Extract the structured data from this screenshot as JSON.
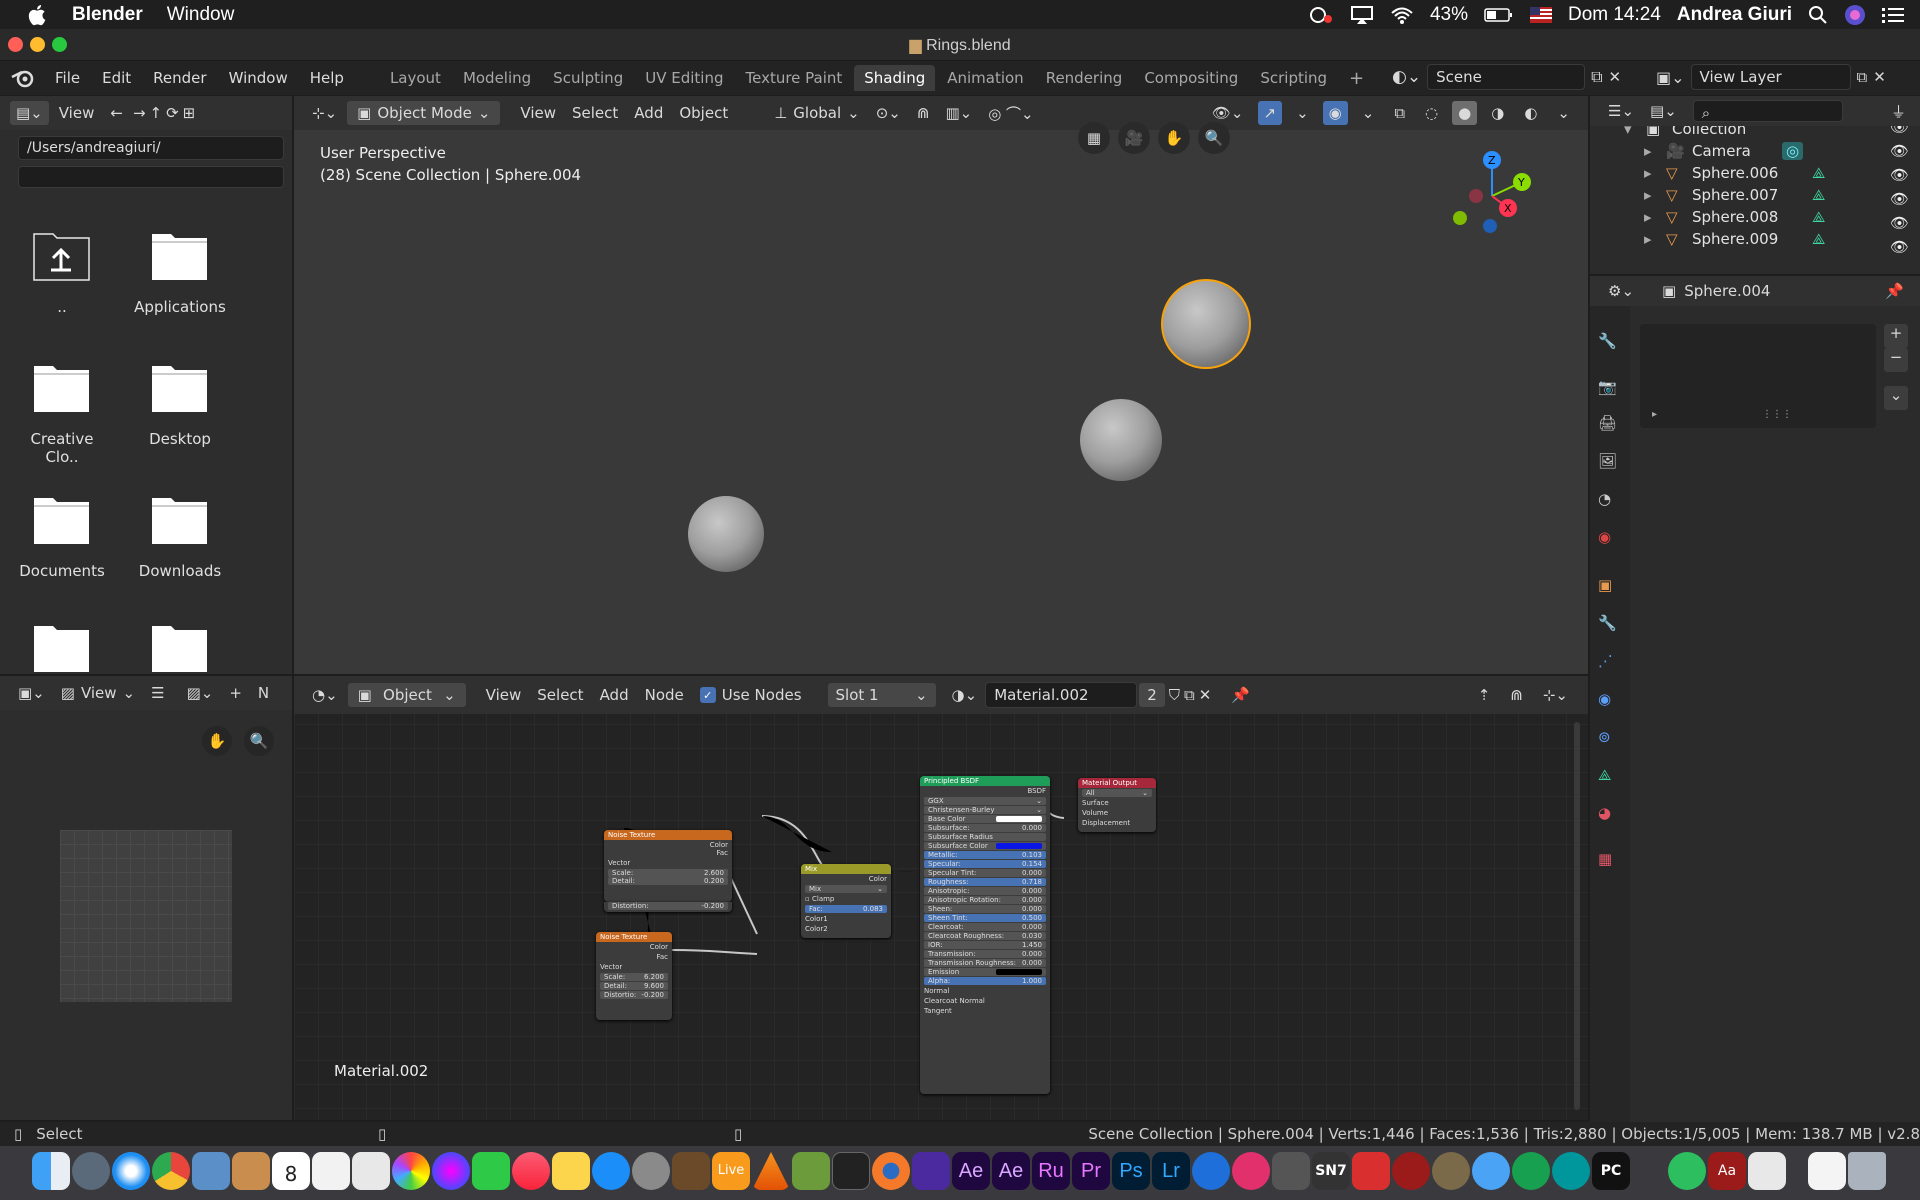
{
  "macbar": {
    "app": "Blender",
    "menu": "Window",
    "battery": "43%",
    "datetime": "Dom 14:24",
    "user": "Andrea Giuri"
  },
  "window": {
    "title": "Rings.blend"
  },
  "topbar": {
    "menus": [
      "File",
      "Edit",
      "Render",
      "Window",
      "Help"
    ],
    "tabs": [
      "Layout",
      "Modeling",
      "Sculpting",
      "UV Editing",
      "Texture Paint",
      "Shading",
      "Animation",
      "Rendering",
      "Compositing",
      "Scripting"
    ],
    "active_tab": "Shading",
    "scene": "Scene",
    "view_layer": "View Layer"
  },
  "filebrowser": {
    "view_label": "View",
    "path": "/Users/andreagiuri/",
    "filter": "",
    "items": [
      "..",
      "Applications",
      "Creative Clo..",
      "Desktop",
      "Documents",
      "Downloads"
    ]
  },
  "viewport": {
    "mode": "Object Mode",
    "menus": [
      "View",
      "Select",
      "Add",
      "Object"
    ],
    "orientation": "Global",
    "overlay_title": "User Perspective",
    "overlay_sub": "(28) Scene Collection | Sphere.004",
    "axes": {
      "z": "Z",
      "y": "Y",
      "x": "X"
    }
  },
  "outliner": {
    "items": [
      {
        "name": "Collection"
      },
      {
        "name": "Camera"
      },
      {
        "name": "Sphere.006"
      },
      {
        "name": "Sphere.007"
      },
      {
        "name": "Sphere.008"
      },
      {
        "name": "Sphere.009"
      }
    ]
  },
  "properties": {
    "object": "Sphere.004"
  },
  "imageeditor": {
    "view_label": "View",
    "n_label": "N"
  },
  "nodeeditor": {
    "object_label": "Object",
    "menus": [
      "View",
      "Select",
      "Add",
      "Node"
    ],
    "use_nodes": "Use Nodes",
    "slot": "Slot 1",
    "material": "Material.002",
    "users": "2",
    "bottom_label": "Material.002",
    "noise1": {
      "title": "Noise Texture",
      "out_color": "Color",
      "out_fac": "Fac",
      "vector": "Vector",
      "scale_l": "Scale:",
      "scale_v": "2.600",
      "detail_l": "Detail:",
      "detail_v": "0.200",
      "distortion_l": "Distortion:",
      "distortion_v": "-0.200"
    },
    "noise2": {
      "title": "Noise Texture",
      "out_color": "Color",
      "out_fac": "Fac",
      "vector": "Vector",
      "scale_l": "Scale:",
      "scale_v": "6.200",
      "detail_l": "Detail:",
      "detail_v": "9.600",
      "distortion_l": "Distortio:",
      "distortion_v": "-0.200"
    },
    "mix": {
      "title": "Mix",
      "out_color": "Color",
      "blend": "Mix",
      "clamp": "Clamp",
      "fac_l": "Fac:",
      "fac_v": "0.083",
      "color1": "Color1",
      "color2": "Color2"
    },
    "bsdf": {
      "title": "Principled BSDF",
      "out": "BSDF",
      "dist": "GGX",
      "sss": "Christensen-Burley",
      "rows": [
        {
          "l": "Base Color",
          "v": ""
        },
        {
          "l": "Subsurface:",
          "v": "0.000"
        },
        {
          "l": "Subsurface Radius",
          "v": ""
        },
        {
          "l": "Subsurface Color",
          "v": ""
        },
        {
          "l": "Metallic:",
          "v": "0.103"
        },
        {
          "l": "Specular:",
          "v": "0.154"
        },
        {
          "l": "Specular Tint:",
          "v": "0.000"
        },
        {
          "l": "Roughness:",
          "v": "0.718"
        },
        {
          "l": "Anisotropic:",
          "v": "0.000"
        },
        {
          "l": "Anisotropic Rotation:",
          "v": "0.000"
        },
        {
          "l": "Sheen:",
          "v": "0.000"
        },
        {
          "l": "Sheen Tint:",
          "v": "0.500"
        },
        {
          "l": "Clearcoat:",
          "v": "0.000"
        },
        {
          "l": "Clearcoat Roughness:",
          "v": "0.030"
        },
        {
          "l": "IOR:",
          "v": "1.450"
        },
        {
          "l": "Transmission:",
          "v": "0.000"
        },
        {
          "l": "Transmission Roughness:",
          "v": "0.000"
        },
        {
          "l": "Emission",
          "v": ""
        },
        {
          "l": "Alpha:",
          "v": "1.000"
        },
        {
          "l": "Normal",
          "v": ""
        },
        {
          "l": "Clearcoat Normal",
          "v": ""
        },
        {
          "l": "Tangent",
          "v": ""
        }
      ]
    },
    "output": {
      "title": "Material Output",
      "target": "All",
      "surface": "Surface",
      "volume": "Volume",
      "displacement": "Displacement"
    }
  },
  "statusbar": {
    "left": "Select",
    "right": "Scene Collection | Sphere.004 | Verts:1,446 | Faces:1,536 | Tris:2,880 | Objects:1/5,005 | Mem: 138.7 MB | v2.8"
  },
  "dock_labels": {
    "calendar_day": "8",
    "live": "Live",
    "ae1": "Ae",
    "ae2": "Ae",
    "ru": "Ru",
    "pr": "Pr",
    "ps": "Ps",
    "lr": "Lr",
    "sn": "SN7",
    "pc": "PC",
    "aa": "Aa"
  }
}
